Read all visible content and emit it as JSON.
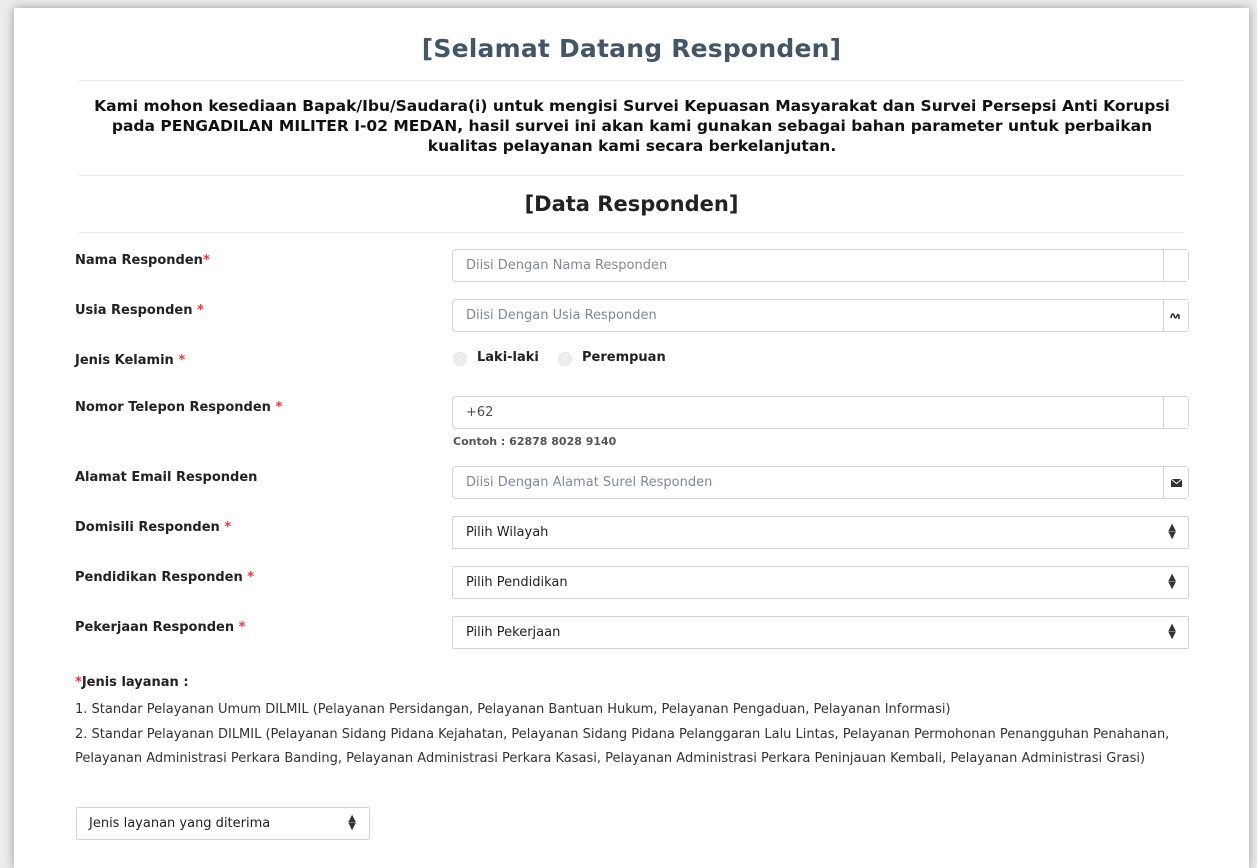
{
  "header": {
    "title": "[Selamat Datang Responden]",
    "intro": "Kami mohon kesediaan Bapak/Ibu/Saudara(i) untuk mengisi Survei Kepuasan Masyarakat dan Survei Persepsi Anti Korupsi pada PENGADILAN MILITER I-02 MEDAN, hasil survei ini akan kami gunakan sebagai bahan parameter untuk perbaikan kualitas pelayanan kami secara berkelanjutan.",
    "subtitle": "[Data Responden]"
  },
  "form": {
    "required_mark": "*",
    "nama": {
      "label": "Nama Responden",
      "placeholder": "Diisi Dengan Nama Responden",
      "value": ""
    },
    "usia": {
      "label": "Usia Responden ",
      "placeholder": "Diisi Dengan Usia Responden",
      "value": "",
      "icon": "sort-numeric-icon"
    },
    "kelamin": {
      "label": "Jenis Kelamin ",
      "options": [
        "Laki-laki",
        "Perempuan"
      ]
    },
    "telepon": {
      "label": "Nomor Telepon Responden ",
      "value": "+62",
      "placeholder": "",
      "hint": "Contoh : 62878 8028 9140"
    },
    "email": {
      "label": "Alamat Email Responden",
      "placeholder": "Diisi Dengan Alamat Surel Responden",
      "value": "",
      "icon": "envelope-icon"
    },
    "domisili": {
      "label": "Domisili Responden ",
      "selected": "Pilih Wilayah"
    },
    "pendidikan": {
      "label": "Pendidikan Responden ",
      "selected": "Pilih Pendidikan"
    },
    "pekerjaan": {
      "label": "Pekerjaan Responden ",
      "selected": "Pilih Pekerjaan"
    }
  },
  "layanan": {
    "title": "Jenis layanan :",
    "item1": "1. Standar Pelayanan Umum DILMIL (Pelayanan Persidangan, Pelayanan Bantuan Hukum, Pelayanan Pengaduan, Pelayanan Informasi)",
    "item2": "2. Standar Pelayanan DILMIL (Pelayanan Sidang Pidana Kejahatan, Pelayanan Sidang Pidana Pelanggaran Lalu Lintas, Pelayanan Permohonan Penangguhan Penahanan, Pelayanan Administrasi Perkara Banding, Pelayanan Administrasi Perkara Kasasi, Pelayanan Administrasi Perkara Peninjauan Kembali, Pelayanan Administrasi Grasi)",
    "selected": "Jenis layanan yang diterima"
  },
  "colors": {
    "title": "#445566",
    "required": "#e03c3c",
    "border": "#cfd4d9"
  }
}
